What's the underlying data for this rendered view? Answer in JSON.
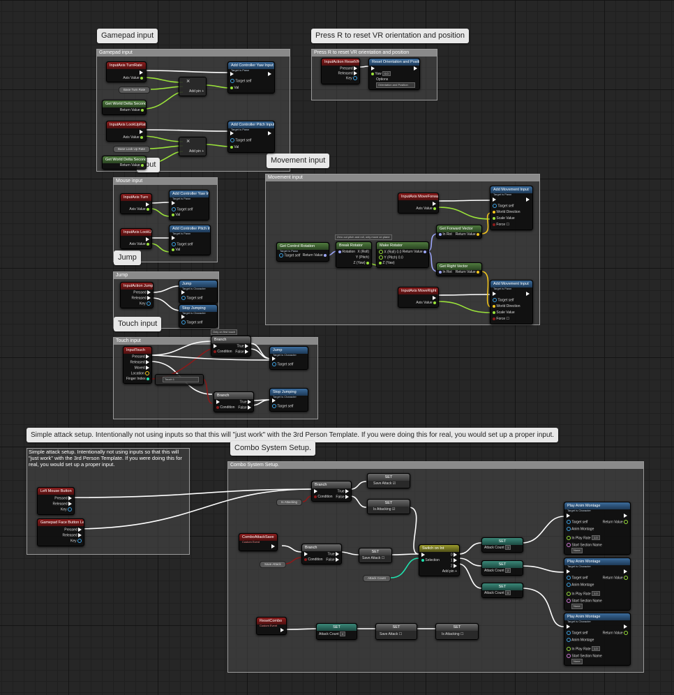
{
  "comments": {
    "gamepad": {
      "bubble": "Gamepad input",
      "title": "Gamepad input"
    },
    "reset": {
      "bubble": "Press R to reset VR orientation and position",
      "title": "Press R to reset VR orientation and position"
    },
    "mouse": {
      "bubble": "nput",
      "title": "Mouse input"
    },
    "movement": {
      "bubble": "Movement input",
      "title": "Movement input"
    },
    "jump": {
      "bubble": "Jump",
      "title": "Jump"
    },
    "touch": {
      "bubble": "Touch input",
      "title": "Touch input"
    },
    "attack": {
      "bubble": "Simple attack setup. Intentionally not using inputs so that this will \"just work\" with the 3rd Person Template. If you were doing this for real, you would set up a proper input.",
      "title": "Simple attack setup. Intentionally not using inputs so that this will \"just work\" with the 3rd Person Template. If you were doing this for real, you would set up a proper input."
    },
    "combo": {
      "bubble": "Combo System Setup.",
      "title": "Combo System Setup."
    }
  },
  "nodes": {
    "turnrate": {
      "title": "InputAxis TurnRate",
      "pin": "Axis Value"
    },
    "baseturn": {
      "label": "Base Turn Rate"
    },
    "delta1": {
      "title": "Get World Delta Seconds",
      "pin": "Return Value"
    },
    "addyaw": {
      "title": "Add Controller Yaw Input",
      "sub": "Target is Pawn",
      "target": "Target",
      "self": "self",
      "val": "Val"
    },
    "mult1": {
      "addpin": "Add pin +"
    },
    "lookuprate": {
      "title": "InputAxis LookUpRate",
      "pin": "Axis Value"
    },
    "baselookup": {
      "label": "Base Look Up Rate"
    },
    "delta2": {
      "title": "Get World Delta Seconds",
      "pin": "Return Value"
    },
    "addpitch": {
      "title": "Add Controller Pitch Input",
      "sub": "Target is Pawn",
      "target": "Target",
      "self": "self",
      "val": "Val"
    },
    "resetvr": {
      "title": "InputAction ResetVR",
      "pressed": "Pressed",
      "released": "Released",
      "key": "Key"
    },
    "resetorient": {
      "title": "Reset Orientation and Position",
      "yaw": "Yaw",
      "yawval": "0.0",
      "options": "Options",
      "optval": "Orientation and Position"
    },
    "turn": {
      "title": "InputAxis Turn",
      "pin": "Axis Value"
    },
    "addyaw2": {
      "title": "Add Controller Yaw Input",
      "sub": "Target is Pawn"
    },
    "lookup": {
      "title": "InputAxis LookUp",
      "pin": "Axis Value"
    },
    "addpitch2": {
      "title": "Add Controller Pitch Input",
      "sub": "Target is Pawn"
    },
    "moveforward": {
      "title": "InputAxis MoveForward",
      "pin": "Axis Value"
    },
    "addmove1": {
      "title": "Add Movement Input",
      "sub": "Target is Pawn",
      "target": "Target",
      "self": "self",
      "dir": "World Direction",
      "scale": "Scale Value",
      "force": "Force"
    },
    "getrot": {
      "title": "Get Control Rotation",
      "sub": "Target is Pawn",
      "target": "Target",
      "self": "self",
      "ret": "Return Value"
    },
    "zerocomment": {
      "label": "Zero out pitch and roll, only move on plane"
    },
    "breakrot": {
      "title": "Break Rotator",
      "rot": "Rotation",
      "x": "X (Roll)",
      "y": "Y (Pitch)",
      "z": "Z (Yaw)"
    },
    "makerot": {
      "title": "Make Rotator",
      "x": "X (Roll)",
      "y": "Y (Pitch)",
      "z": "Z (Yaw)",
      "ret": "Return Value",
      "v0": "0.0"
    },
    "getfwd": {
      "title": "Get Forward Vector",
      "inrot": "In Rot",
      "ret": "Return Value"
    },
    "getright": {
      "title": "Get Right Vector",
      "inrot": "In Rot",
      "ret": "Return Value"
    },
    "moveright": {
      "title": "InputAxis MoveRight",
      "pin": "Axis Value"
    },
    "addmove2": {
      "title": "Add Movement Input",
      "sub": "Target is Pawn"
    },
    "jumpaction": {
      "title": "InputAction Jump",
      "pressed": "Pressed",
      "released": "Released",
      "key": "Key"
    },
    "jumpnode": {
      "title": "Jump",
      "sub": "Target is Character",
      "target": "Target",
      "self": "self"
    },
    "stopjump": {
      "title": "Stop Jumping",
      "sub": "Target is Character",
      "target": "Target",
      "self": "self"
    },
    "onlyfirst": {
      "label": "Only on first touch"
    },
    "inputtouch": {
      "title": "InputTouch",
      "pressed": "Pressed",
      "released": "Released",
      "moved": "Moved",
      "location": "Location",
      "finger": "Finger Index"
    },
    "touchsel": {
      "label": "Touch 1"
    },
    "branchA": {
      "title": "Branch",
      "cond": "Condition",
      "t": "True",
      "f": "False"
    },
    "jump2": {
      "title": "Jump",
      "sub": "Target is Character"
    },
    "branchB": {
      "title": "Branch",
      "cond": "Condition",
      "t": "True",
      "f": "False"
    },
    "stopjump2": {
      "title": "Stop Jumping",
      "sub": "Target is Character"
    },
    "lmb": {
      "title": "Left Mouse Button",
      "pressed": "Pressed",
      "released": "Released",
      "key": "Key"
    },
    "gpface": {
      "title": "Gamepad Face Button Left",
      "pressed": "Pressed",
      "released": "Released",
      "key": "Key"
    },
    "branch1": {
      "title": "Branch",
      "cond": "Condition",
      "t": "True",
      "f": "False"
    },
    "isattacking": {
      "label": "Is Attacking"
    },
    "set1": {
      "title": "SET",
      "pin": "Save Attack"
    },
    "set2": {
      "title": "SET",
      "pin": "Is Attacking"
    },
    "comboevent": {
      "title": "ComboAttackSave",
      "sub": "Custom Event"
    },
    "branch2": {
      "title": "Branch",
      "cond": "Condition",
      "t": "True",
      "f": "False"
    },
    "saveattack": {
      "label": "Save Attack"
    },
    "set3": {
      "title": "SET",
      "pin": "Save Attack"
    },
    "attackcount": {
      "label": "Attack Count"
    },
    "switch": {
      "title": "Switch on Int",
      "sel": "Selection",
      "p0": "0",
      "p1": "1",
      "p2": "2",
      "addpin": "Add pin +"
    },
    "setac0": {
      "title": "SET",
      "pin": "Attack Count",
      "val": "1"
    },
    "setac1": {
      "title": "SET",
      "pin": "Attack Count",
      "val": "2"
    },
    "setac2": {
      "title": "SET",
      "pin": "Attack Count",
      "val": "0"
    },
    "anim1": {
      "title": "Play Anim Montage",
      "sub": "Target is Character",
      "target": "Target",
      "self": "self",
      "ret": "Return Value",
      "montage": "Anim Montage",
      "rate": "In Play Rate",
      "rateval": "1.0",
      "section": "Start Section Name",
      "none": "None"
    },
    "anim2": {
      "title": "Play Anim Montage",
      "sub": "Target is Character"
    },
    "anim3": {
      "title": "Play Anim Montage",
      "sub": "Target is Character"
    },
    "resetcombo": {
      "title": "ResetCombo",
      "sub": "Custom Event"
    },
    "setr1": {
      "title": "SET",
      "pin": "Attack Count",
      "val": "0"
    },
    "setr2": {
      "title": "SET",
      "pin": "Save Attack"
    },
    "setr3": {
      "title": "SET",
      "pin": "Is Attacking"
    }
  },
  "colors": {
    "exec": "#ffffff",
    "float": "#9be33a",
    "object": "#3fa4e6",
    "bool": "#8c1a1a",
    "int": "#1fe3af",
    "rotator": "#9fa9ff",
    "vector": "#f5c71d"
  }
}
